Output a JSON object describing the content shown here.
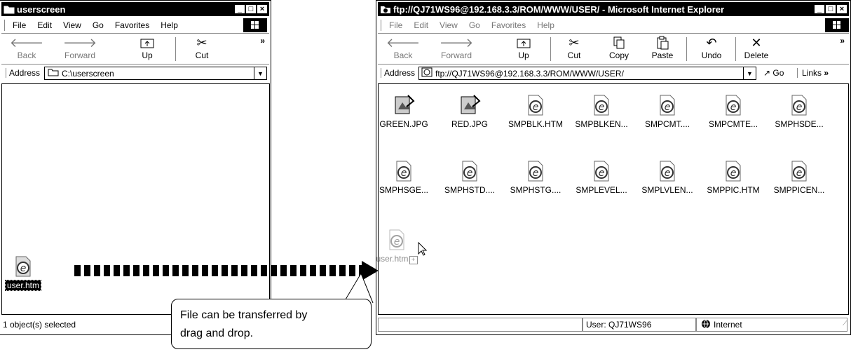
{
  "left_window": {
    "title": "userscreen",
    "menu": [
      "File",
      "Edit",
      "View",
      "Go",
      "Favorites",
      "Help"
    ],
    "toolbar": {
      "back": "Back",
      "forward": "Forward",
      "up": "Up",
      "cut": "Cut"
    },
    "address_label": "Address",
    "address_value": "C:\\userscreen",
    "file": {
      "name": "user.htm"
    },
    "status": "1 object(s) selected"
  },
  "right_window": {
    "title": "ftp://QJ71WS96@192.168.3.3/ROM/WWW/USER/ - Microsoft Internet Explorer",
    "menu": [
      "File",
      "Edit",
      "View",
      "Go",
      "Favorites",
      "Help"
    ],
    "toolbar": {
      "back": "Back",
      "forward": "Forward",
      "up": "Up",
      "cut": "Cut",
      "copy": "Copy",
      "paste": "Paste",
      "undo": "Undo",
      "delete": "Delete"
    },
    "address_label": "Address",
    "address_value": "ftp://QJ71WS96@192.168.3.3/ROM/WWW/USER/",
    "go_label": "Go",
    "links_label": "Links",
    "files": [
      {
        "name": "GREEN.JPG",
        "icon": "image-file-icon"
      },
      {
        "name": "RED.JPG",
        "icon": "image-file-icon"
      },
      {
        "name": "SMPBLK.HTM",
        "icon": "ie-html-file-icon"
      },
      {
        "name": "SMPBLKEN...",
        "icon": "ie-html-file-icon"
      },
      {
        "name": "SMPCMT....",
        "icon": "ie-html-file-icon"
      },
      {
        "name": "SMPCMTE...",
        "icon": "ie-html-file-icon"
      },
      {
        "name": "SMPHSDE...",
        "icon": "ie-html-file-icon"
      },
      {
        "name": "SMPHSGE...",
        "icon": "ie-html-file-icon"
      },
      {
        "name": "SMPHSTD....",
        "icon": "ie-html-file-icon"
      },
      {
        "name": "SMPHSTG....",
        "icon": "ie-html-file-icon"
      },
      {
        "name": "SMPLEVEL...",
        "icon": "ie-html-file-icon"
      },
      {
        "name": "SMPLVLEN...",
        "icon": "ie-html-file-icon"
      },
      {
        "name": "SMPPIC.HTM",
        "icon": "ie-html-file-icon"
      },
      {
        "name": "SMPPICEN...",
        "icon": "ie-html-file-icon"
      }
    ],
    "dragging_file": {
      "name": "user.htm"
    },
    "status_user": "User: QJ71WS96",
    "status_zone": "Internet"
  },
  "callout": {
    "line1": "File can be transferred by",
    "line2": "drag and drop."
  }
}
